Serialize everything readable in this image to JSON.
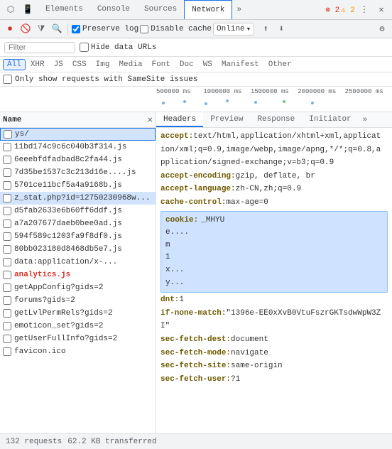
{
  "tabs": {
    "items": [
      {
        "label": "Elements",
        "active": false
      },
      {
        "label": "Console",
        "active": false
      },
      {
        "label": "Sources",
        "active": false
      },
      {
        "label": "Network",
        "active": true
      },
      {
        "label": "»",
        "active": false
      }
    ],
    "errors": {
      "red": "⊗ 2",
      "yellow": "⚠ 2"
    }
  },
  "toolbar": {
    "preserve_log_label": "Preserve log",
    "disable_cache_label": "Disable cache",
    "online_label": "Online",
    "clear_label": "🚫",
    "record_label": "⏺",
    "reload_label": "↺",
    "filter_label": "⧩",
    "search_label": "🔍"
  },
  "filter": {
    "placeholder": "Filter",
    "hide_data_urls_label": "Hide data URLs"
  },
  "type_filters": [
    {
      "label": "All",
      "active": true
    },
    {
      "label": "XHR",
      "active": false
    },
    {
      "label": "JS",
      "active": false
    },
    {
      "label": "CSS",
      "active": false
    },
    {
      "label": "Img",
      "active": false
    },
    {
      "label": "Media",
      "active": false
    },
    {
      "label": "Font",
      "active": false
    },
    {
      "label": "Doc",
      "active": false
    },
    {
      "label": "WS",
      "active": false
    },
    {
      "label": "Manifest",
      "active": false
    },
    {
      "label": "Other",
      "active": false
    }
  ],
  "samesite": {
    "label": "Only show requests with SameSite issues"
  },
  "timeline": {
    "labels": [
      "500000 ms",
      "1000000 ms",
      "1500000 ms",
      "2000000 ms",
      "2500000 ms"
    ]
  },
  "requests": {
    "header_name": "Name",
    "items": [
      {
        "name": "ys/",
        "color": "normal",
        "selected": true,
        "outlined": true
      },
      {
        "name": "11bd174c9c6c040b3f314.js",
        "color": "normal",
        "selected": false
      },
      {
        "name": "6eeebfdfadbad8c2fa44.js",
        "color": "normal",
        "selected": false
      },
      {
        "name": "7d35be1537c3c213d16e....js",
        "color": "normal",
        "selected": false
      },
      {
        "name": "5701ce11bcf5a4a9168b.js",
        "color": "normal",
        "selected": false
      },
      {
        "name": "z_stat.php?id=12750230968w...",
        "color": "normal",
        "selected": false,
        "highlighted": true
      },
      {
        "name": "d5fab2633e6b60ff6ddf.js",
        "color": "normal",
        "selected": false
      },
      {
        "name": "a7a207677daeb0bee0ad.js",
        "color": "normal",
        "selected": false
      },
      {
        "name": "594f589c1203fa9f8df0.js",
        "color": "normal",
        "selected": false
      },
      {
        "name": "80bb023180d8468db5e7.js",
        "color": "normal",
        "selected": false
      },
      {
        "name": "data:application/x-...",
        "color": "normal",
        "selected": false
      },
      {
        "name": "analytics.js",
        "color": "red",
        "selected": false
      },
      {
        "name": "getAppConfig?gids=2",
        "color": "normal",
        "selected": false
      },
      {
        "name": "forums?gids=2",
        "color": "normal",
        "selected": false
      },
      {
        "name": "getLvlPermRels?gids=2",
        "color": "normal",
        "selected": false
      },
      {
        "name": "emoticon_set?gids=2",
        "color": "normal",
        "selected": false
      },
      {
        "name": "getUserFullInfo?gids=2",
        "color": "normal",
        "selected": false
      },
      {
        "name": "favicon.ico",
        "color": "normal",
        "selected": false
      }
    ]
  },
  "details": {
    "tabs": [
      {
        "label": "Headers",
        "active": true
      },
      {
        "label": "Preview",
        "active": false
      },
      {
        "label": "Response",
        "active": false
      },
      {
        "label": "Initiator",
        "active": false
      },
      {
        "label": "»",
        "active": false
      }
    ],
    "headers": [
      {
        "key": "accept: ",
        "val": "text/html,application/xhtml+xml,applicat"
      },
      {
        "key": "",
        "val": "ion/xml;q=0.9,image/webp,image/apng,*/*;q=0.8,a"
      },
      {
        "key": "",
        "val": "pplication/signed-exchange;v=b3;q=0.9"
      },
      {
        "key": "accept-encoding: ",
        "val": "gzip, deflate, br"
      },
      {
        "key": "accept-language: ",
        "val": "zh-CN,zh;q=0.9"
      },
      {
        "key": "cache-control: ",
        "val": "max-age=0"
      }
    ],
    "cookie_label": "cookie: ",
    "cookie_value": "_MHYU",
    "cookie_lines": [
      "e....",
      "m",
      "1",
      "x...",
      "y..."
    ],
    "more_headers": [
      {
        "key": "dnt: ",
        "val": "1"
      },
      {
        "key": "if-none-match: ",
        "val": "\"1396e-EE0xXvB0VtuFszrGKTsdwWpW3Z"
      },
      {
        "key": "",
        "val": "I\""
      },
      {
        "key": "sec-fetch-dest: ",
        "val": "document"
      },
      {
        "key": "sec-fetch-mode: ",
        "val": "navigate"
      },
      {
        "key": "sec-fetch-site: ",
        "val": "same-origin"
      },
      {
        "key": "sec-fetch-user: ",
        "val": "?1"
      }
    ]
  },
  "status_bar": {
    "requests_count": "132 requests",
    "transferred": "62.2 KB transferred"
  }
}
